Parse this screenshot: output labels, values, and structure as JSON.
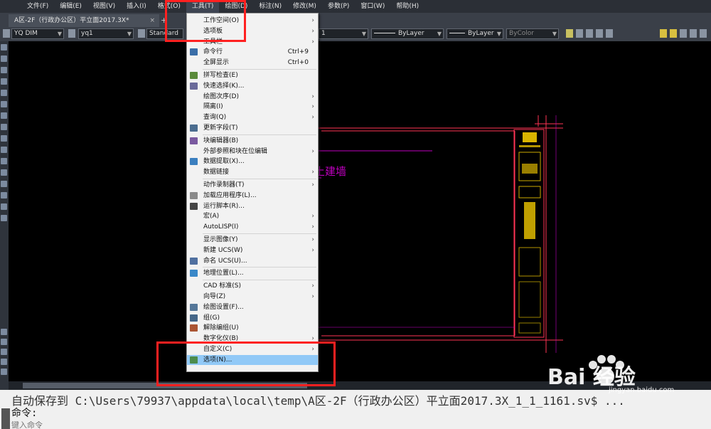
{
  "menubar": {
    "items": [
      "文件(F)",
      "编辑(E)",
      "视图(V)",
      "插入(I)",
      "格式(O)",
      "工具(T)",
      "绘图(D)",
      "标注(N)",
      "修改(M)",
      "参数(P)",
      "窗口(W)",
      "帮助(H)"
    ]
  },
  "tabs": {
    "doc_title": "A区-2F（行政办公区）平立面2017.3X*",
    "close": "×",
    "plus": "+"
  },
  "toolbar": {
    "dimstyle": "YQ DIM",
    "layer": "yq1",
    "textstyle": "Standard",
    "layer2": "1",
    "linetype1": "ByLayer",
    "linetype2": "ByLayer",
    "color": "ByColor"
  },
  "dropdown": {
    "items": [
      {
        "label": "工作空间(O)",
        "shortcut": "",
        "submenu": true,
        "icon": "none"
      },
      {
        "label": "选项板",
        "shortcut": "",
        "submenu": true,
        "icon": "none"
      },
      {
        "label": "工具栏",
        "shortcut": "",
        "submenu": true,
        "icon": "none"
      },
      {
        "label": "命令行",
        "shortcut": "Ctrl+9",
        "submenu": false,
        "icon": "command-line-icon"
      },
      {
        "label": "全屏显示",
        "shortcut": "Ctrl+0",
        "submenu": false,
        "icon": "none"
      },
      {
        "label": "拼写检查(E)",
        "shortcut": "",
        "submenu": false,
        "icon": "spell-check-icon"
      },
      {
        "label": "快速选择(K)...",
        "shortcut": "",
        "submenu": false,
        "icon": "quick-select-icon"
      },
      {
        "label": "绘图次序(D)",
        "shortcut": "",
        "submenu": true,
        "icon": "none"
      },
      {
        "label": "隔离(I)",
        "shortcut": "",
        "submenu": true,
        "icon": "none"
      },
      {
        "label": "查询(Q)",
        "shortcut": "",
        "submenu": true,
        "icon": "none"
      },
      {
        "label": "更新字段(T)",
        "shortcut": "",
        "submenu": false,
        "icon": "update-field-icon"
      },
      {
        "label": "块编辑器(B)",
        "shortcut": "",
        "submenu": false,
        "icon": "block-editor-icon"
      },
      {
        "label": "外部参照和块在位编辑",
        "shortcut": "",
        "submenu": true,
        "icon": "none"
      },
      {
        "label": "数据提取(X)...",
        "shortcut": "",
        "submenu": false,
        "icon": "data-extract-icon"
      },
      {
        "label": "数据链接",
        "shortcut": "",
        "submenu": true,
        "icon": "none"
      },
      {
        "label": "动作录制器(T)",
        "shortcut": "",
        "submenu": true,
        "icon": "none"
      },
      {
        "label": "加载应用程序(L)...",
        "shortcut": "",
        "submenu": false,
        "icon": "load-app-icon"
      },
      {
        "label": "运行脚本(R)...",
        "shortcut": "",
        "submenu": false,
        "icon": "run-script-icon"
      },
      {
        "label": "宏(A)",
        "shortcut": "",
        "submenu": true,
        "icon": "none"
      },
      {
        "label": "AutoLISP(I)",
        "shortcut": "",
        "submenu": true,
        "icon": "none"
      },
      {
        "label": "显示图像(Y)",
        "shortcut": "",
        "submenu": true,
        "icon": "none"
      },
      {
        "label": "新建 UCS(W)",
        "shortcut": "",
        "submenu": true,
        "icon": "none"
      },
      {
        "label": "命名 UCS(U)...",
        "shortcut": "",
        "submenu": false,
        "icon": "named-ucs-icon"
      },
      {
        "label": "地理位置(L)...",
        "shortcut": "",
        "submenu": false,
        "icon": "geo-location-icon"
      },
      {
        "label": "CAD 标准(S)",
        "shortcut": "",
        "submenu": true,
        "icon": "none"
      },
      {
        "label": "向导(Z)",
        "shortcut": "",
        "submenu": true,
        "icon": "none"
      },
      {
        "label": "绘图设置(F)...",
        "shortcut": "",
        "submenu": false,
        "icon": "drafting-settings-icon"
      },
      {
        "label": "组(G)",
        "shortcut": "",
        "submenu": false,
        "icon": "group-icon"
      },
      {
        "label": "解除编组(U)",
        "shortcut": "",
        "submenu": false,
        "icon": "ungroup-icon"
      },
      {
        "label": "数字化仪(B)",
        "shortcut": "",
        "submenu": true,
        "icon": "none"
      },
      {
        "label": "自定义(C)",
        "shortcut": "",
        "submenu": true,
        "icon": "none"
      },
      {
        "label": "选项(N)...",
        "shortcut": "",
        "submenu": false,
        "icon": "options-icon"
      }
    ]
  },
  "drawing": {
    "text": "土建墙"
  },
  "command": {
    "history": "自动保存到 C:\\Users\\79937\\appdata\\local\\temp\\A区-2F（行政办公区）平立面2017.3X_1_1_1161.sv$ ...",
    "prompt": "命令:",
    "input_placeholder": "键入命令"
  },
  "watermark": {
    "main": "Bai 经验",
    "sub": "jingyan.baidu.com"
  },
  "colors": {
    "menu_bg": "#2b2f36",
    "highlight": "#91c9f7",
    "red_annotation": "#ff2020",
    "drawing_red": "#ff3355",
    "drawing_magenta": "#c000c0",
    "drawing_yellow": "#ffd400"
  }
}
